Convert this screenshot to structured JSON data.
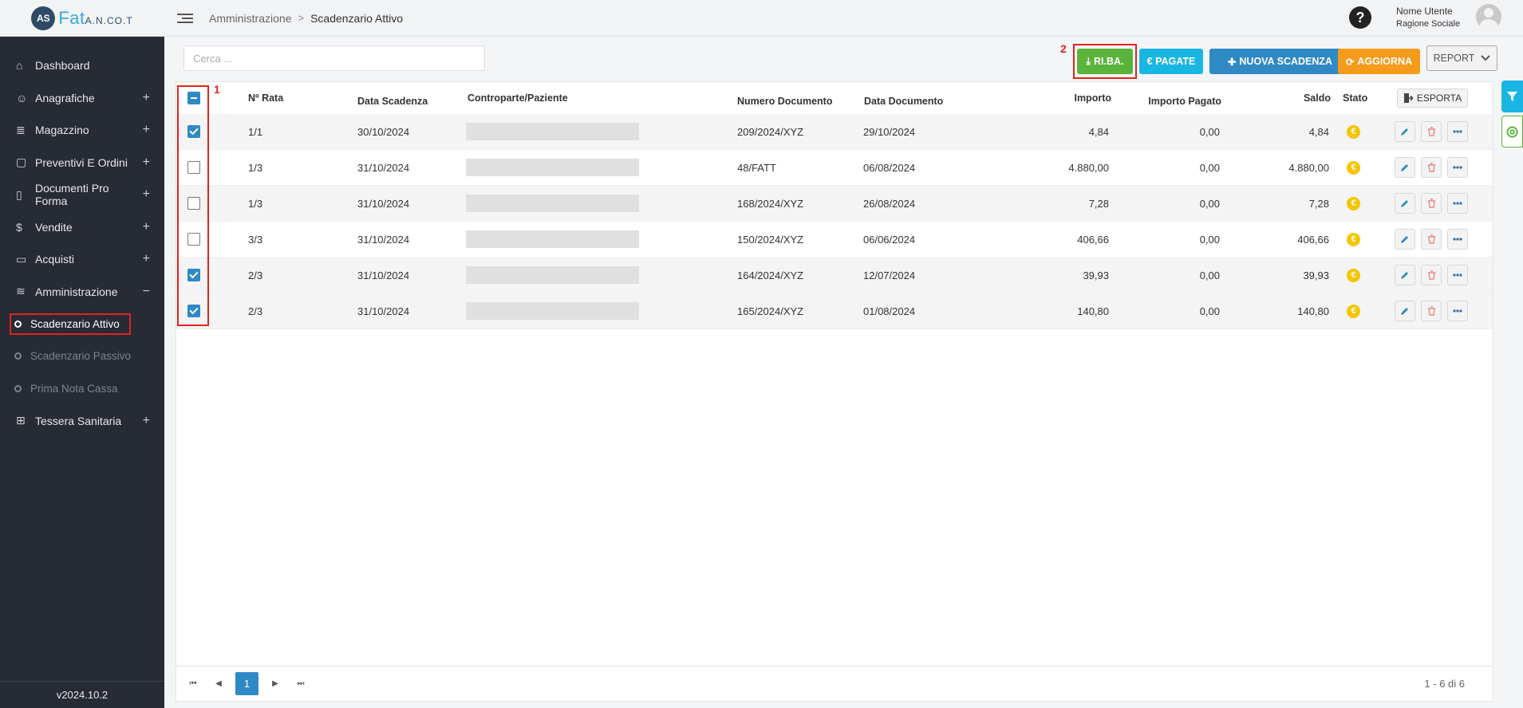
{
  "app": {
    "logo_mark": "AS",
    "logo_name": "Fat",
    "logo_suffix": "A.N.CO.T",
    "version": "v2024.10.2"
  },
  "breadcrumb": {
    "parent": "Amministrazione",
    "separator": ">",
    "current": "Scadenzario Attivo"
  },
  "user": {
    "name": "Nome Utente",
    "company": "Ragione Sociale"
  },
  "sidebar": {
    "items": [
      {
        "label": "Dashboard",
        "icon": "home-icon",
        "glyph": "⌂",
        "toggle": ""
      },
      {
        "label": "Anagrafiche",
        "icon": "user-icon",
        "glyph": "☺",
        "toggle": "+"
      },
      {
        "label": "Magazzino",
        "icon": "list-icon",
        "glyph": "≣",
        "toggle": "+"
      },
      {
        "label": "Preventivi E Ordini",
        "icon": "clipboard-icon",
        "glyph": "▢",
        "toggle": "+"
      },
      {
        "label": "Documenti Pro Forma",
        "icon": "document-icon",
        "glyph": "▯",
        "toggle": "+"
      },
      {
        "label": "Vendite",
        "icon": "dollar-icon",
        "glyph": "$",
        "toggle": "+"
      },
      {
        "label": "Acquisti",
        "icon": "credit-card-icon",
        "glyph": "▭",
        "toggle": "+"
      },
      {
        "label": "Amministrazione",
        "icon": "database-icon",
        "glyph": "≋",
        "toggle": "−"
      }
    ],
    "subitems": [
      {
        "label": "Scadenzario Attivo",
        "active": true
      },
      {
        "label": "Scadenzario Passivo",
        "active": false
      },
      {
        "label": "Prima Nota Cassa",
        "active": false
      }
    ],
    "last_item": {
      "label": "Tessera Sanitaria",
      "icon": "medical-card-icon",
      "glyph": "⊞",
      "toggle": "+"
    }
  },
  "toolbar": {
    "search_placeholder": "Cerca ...",
    "riba_label": "RI.BA.",
    "pagate_label": "€ PAGATE",
    "nuova_label": "NUOVA SCADENZA",
    "aggiorna_label": "AGGIORNA",
    "report_label": "REPORT"
  },
  "annotations": {
    "marker_1": "1",
    "marker_2": "2"
  },
  "table": {
    "columns": {
      "rata": "Nº Rata",
      "data_scadenza": "Data Scadenza",
      "controparte": "Controparte/Paziente",
      "numero_documento": "Numero Documento",
      "data_documento": "Data Documento",
      "importo": "Importo",
      "importo_pagato": "Importo Pagato",
      "saldo": "Saldo",
      "stato": "Stato",
      "esporta": "ESPORTA"
    },
    "rows": [
      {
        "checked": true,
        "rata": "1/1",
        "data_scadenza": "30/10/2024",
        "numero_documento": "209/2024/XYZ",
        "data_documento": "29/10/2024",
        "importo": "4,84",
        "importo_pagato": "0,00",
        "saldo": "4,84"
      },
      {
        "checked": false,
        "rata": "1/3",
        "data_scadenza": "31/10/2024",
        "numero_documento": "48/FATT",
        "data_documento": "06/08/2024",
        "importo": "4.880,00",
        "importo_pagato": "0,00",
        "saldo": "4.880,00"
      },
      {
        "checked": false,
        "rata": "1/3",
        "data_scadenza": "31/10/2024",
        "numero_documento": "168/2024/XYZ",
        "data_documento": "26/08/2024",
        "importo": "7,28",
        "importo_pagato": "0,00",
        "saldo": "7,28"
      },
      {
        "checked": false,
        "rata": "3/3",
        "data_scadenza": "31/10/2024",
        "numero_documento": "150/2024/XYZ",
        "data_documento": "06/06/2024",
        "importo": "406,66",
        "importo_pagato": "0,00",
        "saldo": "406,66"
      },
      {
        "checked": true,
        "rata": "2/3",
        "data_scadenza": "31/10/2024",
        "numero_documento": "164/2024/XYZ",
        "data_documento": "12/07/2024",
        "importo": "39,93",
        "importo_pagato": "0,00",
        "saldo": "39,93"
      },
      {
        "checked": true,
        "rata": "2/3",
        "data_scadenza": "31/10/2024",
        "numero_documento": "165/2024/XYZ",
        "data_documento": "01/08/2024",
        "importo": "140,80",
        "importo_pagato": "0,00",
        "saldo": "140,80"
      }
    ]
  },
  "pager": {
    "current_page": "1",
    "info": "1 - 6 di 6"
  },
  "colors": {
    "accent_blue": "#2f89c5",
    "green": "#5ab43c",
    "cyan": "#1ab6e3",
    "orange": "#f59b1a",
    "highlight_red": "#e0231f",
    "status_yellow": "#f5c600"
  }
}
